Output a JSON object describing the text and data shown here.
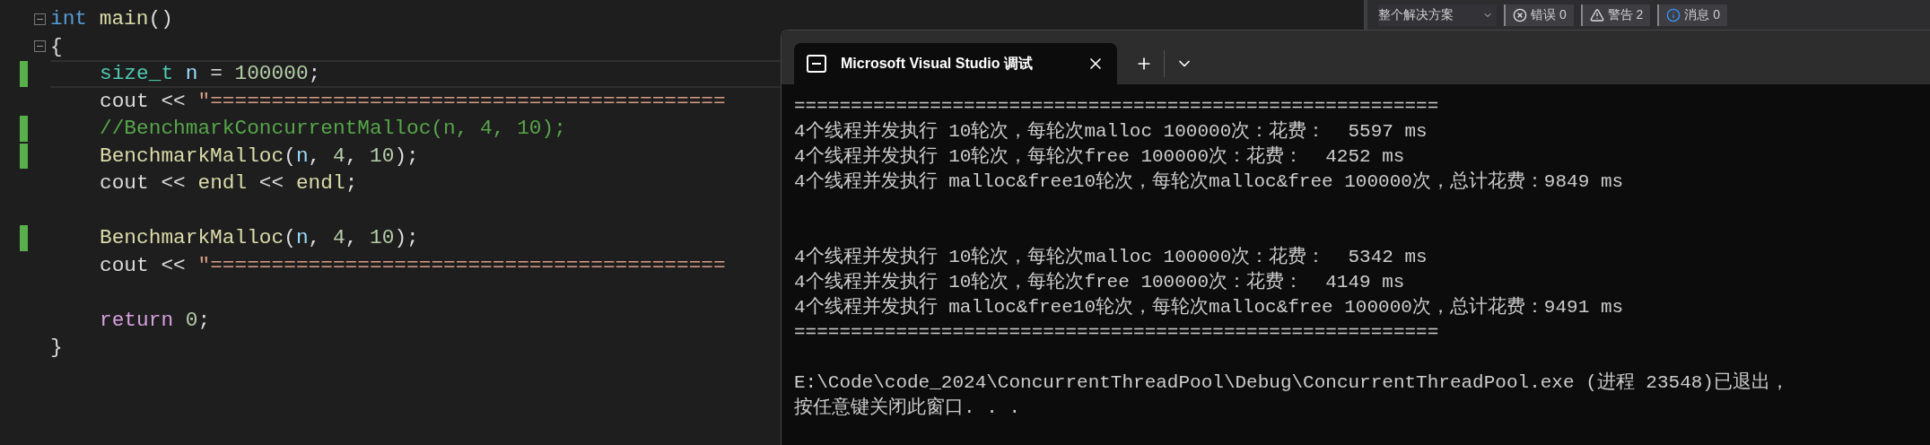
{
  "editor": {
    "lines": [
      {
        "fold": true,
        "changed": false,
        "current": false,
        "tokens": [
          {
            "kind": "keyword",
            "text": "int "
          },
          {
            "kind": "func",
            "text": "main"
          },
          {
            "kind": "plain",
            "text": "()"
          }
        ]
      },
      {
        "fold": true,
        "changed": false,
        "current": false,
        "tokens": [
          {
            "kind": "plain",
            "text": "{"
          }
        ],
        "children": [
          {
            "fold": false,
            "changed": true,
            "current": true,
            "tokens": [
              {
                "kind": "type",
                "text": "size_t "
              },
              {
                "kind": "var",
                "text": "n"
              },
              {
                "kind": "plain",
                "text": " = "
              },
              {
                "kind": "num",
                "text": "100000"
              },
              {
                "kind": "plain",
                "text": ";"
              }
            ]
          },
          {
            "fold": false,
            "changed": false,
            "current": false,
            "tokens": [
              {
                "kind": "plain",
                "text": "cout << "
              },
              {
                "kind": "str",
                "text": "\"=========================================="
              }
            ]
          },
          {
            "fold": false,
            "changed": true,
            "current": false,
            "tokens": [
              {
                "kind": "comment",
                "text": "//BenchmarkConcurrentMalloc(n, 4, 10);"
              }
            ]
          },
          {
            "fold": false,
            "changed": true,
            "current": false,
            "tokens": [
              {
                "kind": "func",
                "text": "BenchmarkMalloc"
              },
              {
                "kind": "plain",
                "text": "("
              },
              {
                "kind": "var",
                "text": "n"
              },
              {
                "kind": "plain",
                "text": ", "
              },
              {
                "kind": "num",
                "text": "4"
              },
              {
                "kind": "plain",
                "text": ", "
              },
              {
                "kind": "num",
                "text": "10"
              },
              {
                "kind": "plain",
                "text": ");"
              }
            ]
          },
          {
            "fold": false,
            "changed": false,
            "current": false,
            "tokens": [
              {
                "kind": "plain",
                "text": "cout << "
              },
              {
                "kind": "func",
                "text": "endl"
              },
              {
                "kind": "plain",
                "text": " << "
              },
              {
                "kind": "func",
                "text": "endl"
              },
              {
                "kind": "plain",
                "text": ";"
              }
            ]
          },
          {
            "fold": false,
            "changed": false,
            "current": false
          },
          {
            "fold": false,
            "changed": true,
            "current": false,
            "tokens": [
              {
                "kind": "func",
                "text": "BenchmarkMalloc"
              },
              {
                "kind": "plain",
                "text": "("
              },
              {
                "kind": "var",
                "text": "n"
              },
              {
                "kind": "plain",
                "text": ", "
              },
              {
                "kind": "num",
                "text": "4"
              },
              {
                "kind": "plain",
                "text": ", "
              },
              {
                "kind": "num",
                "text": "10"
              },
              {
                "kind": "plain",
                "text": ");"
              }
            ]
          },
          {
            "fold": false,
            "changed": false,
            "current": false,
            "tokens": [
              {
                "kind": "plain",
                "text": "cout << "
              },
              {
                "kind": "str",
                "text": "\"=========================================="
              }
            ]
          },
          {
            "fold": false,
            "changed": false,
            "current": false
          },
          {
            "fold": false,
            "changed": false,
            "current": false,
            "tokens": [
              {
                "kind": "control",
                "text": "return "
              },
              {
                "kind": "num",
                "text": "0"
              },
              {
                "kind": "plain",
                "text": ";"
              }
            ]
          }
        ]
      },
      {
        "fold": false,
        "changed": false,
        "current": false,
        "tokens": [
          {
            "kind": "plain",
            "text": "}"
          }
        ]
      }
    ]
  },
  "error_list": {
    "scope": "整个解决方案",
    "filters": [
      {
        "kind": "error",
        "label": "错误 0"
      },
      {
        "kind": "warning",
        "label": "警告 2"
      },
      {
        "kind": "info",
        "label": "消息 0"
      }
    ]
  },
  "terminal": {
    "tab": {
      "title": "Microsoft Visual Studio 调试"
    },
    "lines": [
      {
        "kind": "text",
        "text": "========================================================="
      },
      {
        "kind": "text",
        "text": "4个线程并发执行 10轮次，每轮次malloc 100000次：花费：  5597 ms"
      },
      {
        "kind": "text",
        "text": "4个线程并发执行 10轮次，每轮次free 100000次：花费：  4252 ms"
      },
      {
        "kind": "text",
        "text": "4个线程并发执行 malloc&free10轮次，每轮次malloc&free 100000次，总计花费：9849 ms"
      },
      {
        "kind": "blank"
      },
      {
        "kind": "blank"
      },
      {
        "kind": "text",
        "text": "4个线程并发执行 10轮次，每轮次malloc 100000次：花费：  5342 ms"
      },
      {
        "kind": "text",
        "text": "4个线程并发执行 10轮次，每轮次free 100000次：花费：  4149 ms"
      },
      {
        "kind": "text",
        "text": "4个线程并发执行 malloc&free10轮次，每轮次malloc&free 100000次，总计花费：9491 ms"
      },
      {
        "kind": "text",
        "text": "========================================================="
      },
      {
        "kind": "blank"
      },
      {
        "kind": "text",
        "text": "E:\\Code\\code_2024\\ConcurrentThreadPool\\Debug\\ConcurrentThreadPool.exe (进程 23548)已退出，"
      },
      {
        "kind": "text",
        "text": "按任意键关闭此窗口. . ."
      }
    ]
  }
}
